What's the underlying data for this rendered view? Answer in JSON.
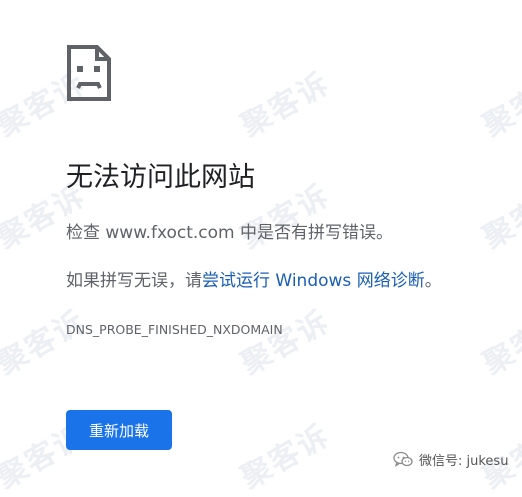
{
  "watermark": {
    "text": "聚客诉"
  },
  "error_page": {
    "title": "无法访问此网站",
    "check_prefix": "检查 ",
    "domain": "www.fxoct.com",
    "check_suffix": " 中是否有拼写错误。",
    "spelling_prefix": "如果拼写无误，请",
    "diagnostics_link": "尝试运行 Windows 网络诊断",
    "spelling_suffix": "。",
    "error_code": "DNS_PROBE_FINISHED_NXDOMAIN",
    "reload_label": "重新加载"
  },
  "footer": {
    "wechat_label": "微信号: jukesu"
  },
  "colors": {
    "button_blue": "#1a73e8",
    "link_blue": "#1a5fb4",
    "title_text": "#202124",
    "body_text": "#5f6368"
  },
  "icons": {
    "error": "sad-document-icon",
    "wechat": "wechat-icon"
  }
}
